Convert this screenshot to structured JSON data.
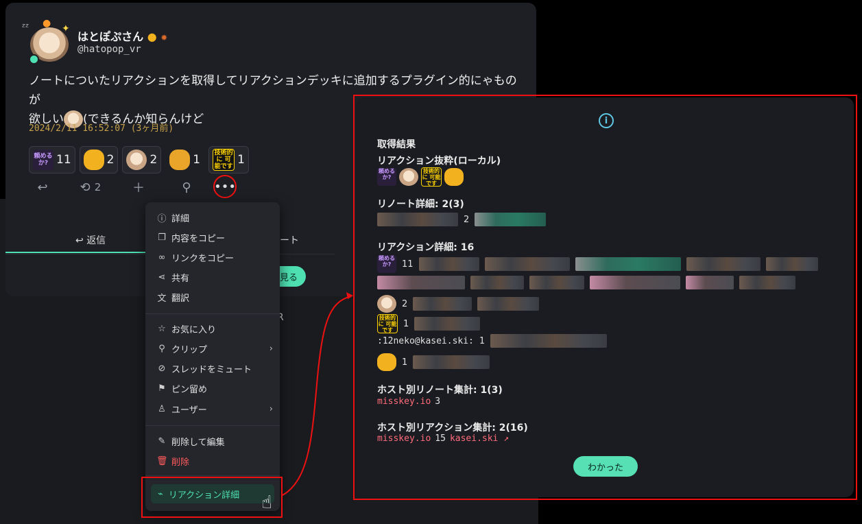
{
  "note": {
    "username": "はとぽぷさん",
    "handle": "@hatopop_vr",
    "text_line1": "ノートについたリアクションを取得してリアクションデッキに追加するプラグイン的にゃものが",
    "text_line2_a": "欲しい",
    "text_line2_b": "(できるんか知らんけど",
    "timestamp": "2024/2/11 16:52:07 (3ヶ月前)",
    "reactions": [
      {
        "emoji_text": "頼める か?",
        "count": "11"
      },
      {
        "emoji_text": "",
        "count": "2"
      },
      {
        "emoji_text": "",
        "count": "2"
      },
      {
        "emoji_text": "",
        "count": "1"
      },
      {
        "emoji_text": "技術的に 可能です",
        "count": "1"
      }
    ],
    "renote_count": "2",
    "tab_reply": "返信",
    "tab_renote": "ート",
    "see_more": "見る",
    "stray_text": "R"
  },
  "menu": {
    "items": [
      {
        "label": "詳細",
        "icon": "info-icon"
      },
      {
        "label": "内容をコピー",
        "icon": "copy-icon"
      },
      {
        "label": "リンクをコピー",
        "icon": "link-icon"
      },
      {
        "label": "共有",
        "icon": "share-icon"
      },
      {
        "label": "翻訳",
        "icon": "translate-icon"
      },
      {
        "label": "お気に入り",
        "icon": "star-icon"
      },
      {
        "label": "クリップ",
        "icon": "paperclip-icon"
      },
      {
        "label": "スレッドをミュート",
        "icon": "mute-icon"
      },
      {
        "label": "ピン留め",
        "icon": "pin-icon"
      },
      {
        "label": "ユーザー",
        "icon": "user-icon"
      },
      {
        "label": "削除して編集",
        "icon": "edit-icon"
      },
      {
        "label": "削除",
        "icon": "trash-icon"
      }
    ],
    "highlighted": "リアクション詳細"
  },
  "dialog": {
    "section_title": "取得結果",
    "local_title": "リアクション抜粋(ローカル)",
    "local_emoji_1": "頼める か?",
    "local_emoji_3": "技術的に 可能です",
    "renote_title": "リノート詳細: 2(3)",
    "renote_count": "2",
    "reaction_title": "リアクション詳細: 16",
    "reaction_rows": [
      {
        "emoji_text": "頼める か?",
        "count": "11"
      },
      {
        "emoji_text": "",
        "count": "2"
      },
      {
        "emoji_text": "技術的に 可能です",
        "count": "1"
      },
      {
        "emoji_text": ":12neko@kasei.ski:",
        "count": "1"
      },
      {
        "emoji_text": "",
        "count": "1"
      }
    ],
    "host_renote_title": "ホスト別リノート集計: 1(3)",
    "host_renote_host": "misskey.io",
    "host_renote_count": "3",
    "host_reaction_title": "ホスト別リアクション集計: 2(16)",
    "host_reaction_host1": "misskey.io",
    "host_reaction_count1": "15",
    "host_reaction_host2": "kasei.ski",
    "ok_button": "わかった"
  },
  "colors": {
    "accent": "#4ee0b1",
    "danger": "#ff5a5a",
    "highlight_frame": "#e11111",
    "host_link": "#ff6b7a"
  }
}
